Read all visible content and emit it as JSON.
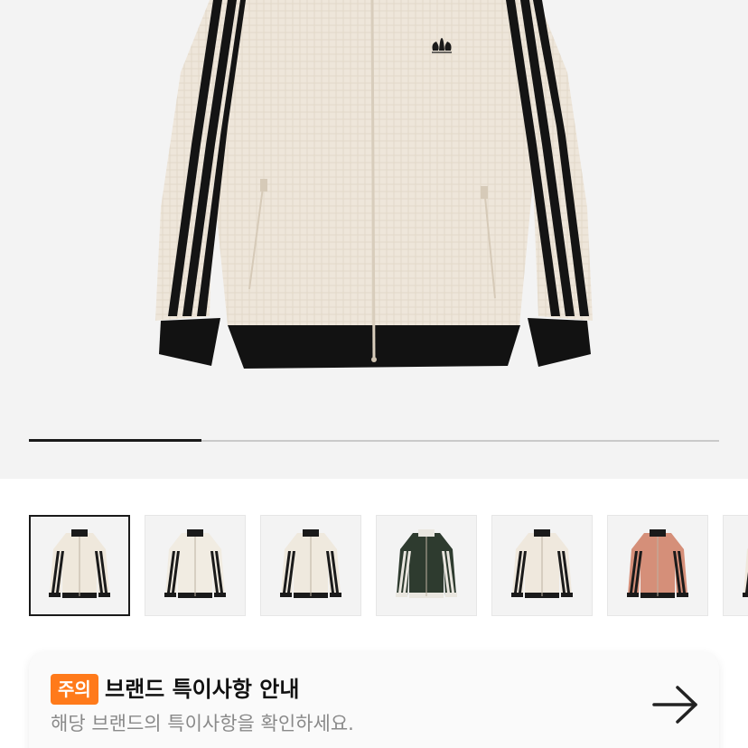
{
  "gallery": {
    "current_index": 1,
    "total": 4,
    "progress_fraction": 0.25,
    "thumbnails": [
      {
        "name": "thumb-cream-jacket-1",
        "body": "#efe8dc",
        "stripe": "#1a1a1a",
        "collar": "#1a1a1a",
        "cuff": "#1a1a1a"
      },
      {
        "name": "thumb-cream-jacket-2",
        "body": "#f1ece2",
        "stripe": "#1a1a1a",
        "collar": "#1a1a1a",
        "cuff": "#1a1a1a"
      },
      {
        "name": "thumb-cream-jacket-3",
        "body": "#efe9de",
        "stripe": "#1a1a1a",
        "collar": "#1a1a1a",
        "cuff": "#1a1a1a"
      },
      {
        "name": "thumb-dark-green-jacket",
        "body": "#2e3b2f",
        "stripe": "#e9e6df",
        "collar": "#e9e6df",
        "cuff": "#e9e6df"
      },
      {
        "name": "thumb-cream-jacket-5",
        "body": "#efe8dd",
        "stripe": "#1a1a1a",
        "collar": "#1a1a1a",
        "cuff": "#1a1a1a"
      },
      {
        "name": "thumb-salmon-jacket",
        "body": "#d58f79",
        "stripe": "#1a1a1a",
        "collar": "#1a1a1a",
        "cuff": "#1a1a1a"
      },
      {
        "name": "thumb-partial",
        "body": "#efe8dc",
        "stripe": "#1a1a1a",
        "collar": "#1a1a1a",
        "cuff": "#1a1a1a"
      }
    ]
  },
  "hero": {
    "logo_text": "adidas",
    "jacket_color": "#eee6da",
    "stripe_color": "#141414"
  },
  "notice": {
    "badge": "주의",
    "title": "브랜드 특이사항 안내",
    "subtitle": "해당 브랜드의 특이사항을 확인하세요.",
    "badge_color": "#ff7a1a",
    "icon": "arrow-right-icon"
  }
}
